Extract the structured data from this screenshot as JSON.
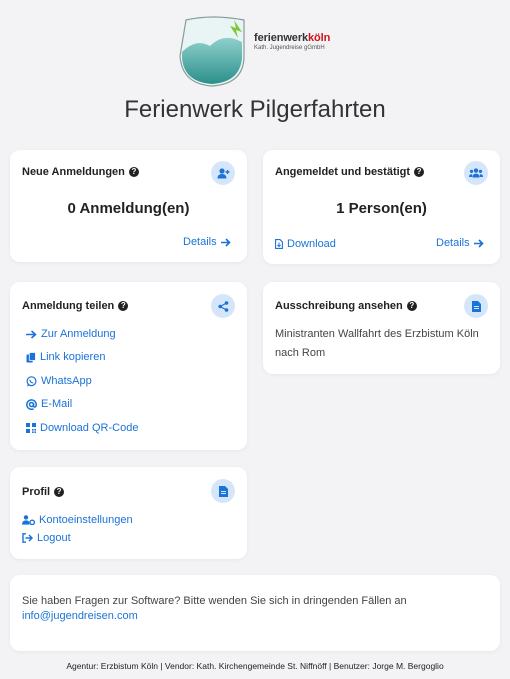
{
  "logo": {
    "main_a": "ferienwerk",
    "main_b": "köln",
    "sub": "Kath. Jugendreise gGmbH",
    "colors": {
      "teal": "#3fa7a3",
      "green": "#7cc83a",
      "red": "#d0131c"
    }
  },
  "page_title": "Ferienwerk Pilgerfahrten",
  "cards": {
    "new_registrations": {
      "title": "Neue Anmeldungen",
      "icon": "user-plus-icon",
      "value": "0 Anmeldung(en)",
      "details_label": "Details"
    },
    "confirmed": {
      "title": "Angemeldet und bestätigt",
      "icon": "users-icon",
      "value": "1 Person(en)",
      "download_label": "Download",
      "details_label": "Details"
    },
    "share": {
      "title": "Anmeldung teilen",
      "icon": "share-icon",
      "links": [
        {
          "label": "Zur Anmeldung",
          "icon": "arrow-right-icon"
        },
        {
          "label": "Link kopieren",
          "icon": "copy-icon"
        },
        {
          "label": "WhatsApp",
          "icon": "whatsapp-icon"
        },
        {
          "label": "E-Mail",
          "icon": "at-icon"
        },
        {
          "label": "Download QR-Code",
          "icon": "qrcode-icon"
        }
      ]
    },
    "announcement": {
      "title": "Ausschreibung ansehen",
      "icon": "document-icon",
      "text_line1": "Ministranten Wallfahrt des Erzbistum Köln",
      "text_line2": "nach Rom"
    },
    "profile": {
      "title": "Profil",
      "icon": "document-icon",
      "links": [
        {
          "label": "Kontoeinstellungen",
          "icon": "user-cog-icon"
        },
        {
          "label": "Logout",
          "icon": "logout-icon"
        }
      ]
    },
    "contact": {
      "text": "Sie haben Fragen zur Software? Bitte wenden Sie sich in dringenden Fällen an",
      "email": "info@jugendreisen.com"
    }
  },
  "footer": "Agentur: Erzbistum Köln | Vendor: Kath. Kirchengemeinde St. Niffnöff | Benutzer: Jorge M. Bergoglio",
  "colors": {
    "accent": "#1a73d8",
    "icon_bg": "#d6e6fa",
    "page_bg": "#f3f3f5"
  }
}
